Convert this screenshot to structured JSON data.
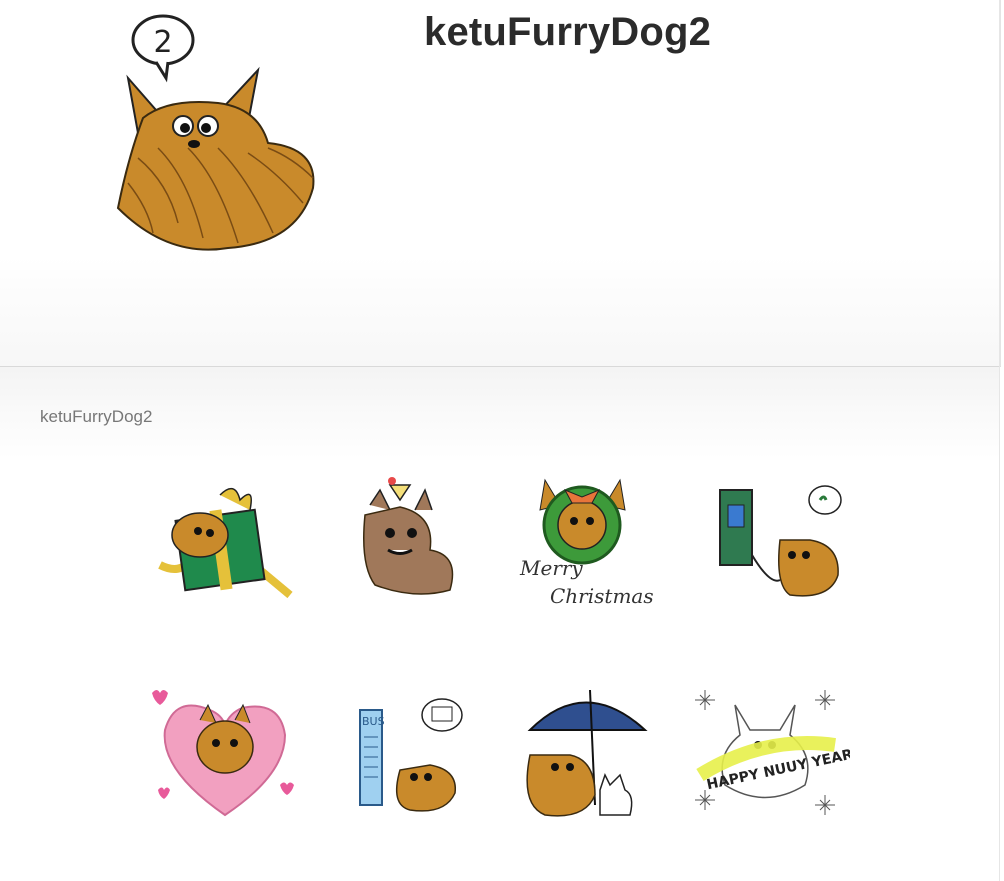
{
  "header": {
    "title": "ketuFurryDog2",
    "main_sticker_icon": "furry-dog-speech-bubble-2",
    "main_sticker_bubble_text": "2"
  },
  "pack": {
    "label": "ketuFurryDog2"
  },
  "stickers": [
    {
      "name": "dog-in-gift-box",
      "icon": "gift-box-dog"
    },
    {
      "name": "dog-with-cocktail-hat",
      "icon": "cocktail-dog"
    },
    {
      "name": "dog-christmas-wreath",
      "icon": "wreath-dog",
      "text": "Merry Christmas"
    },
    {
      "name": "dog-phone-booth",
      "icon": "phone-dog"
    },
    {
      "name": "dog-pink-heart",
      "icon": "heart-dog"
    },
    {
      "name": "dog-bus-stop",
      "icon": "bus-dog",
      "text": "BUS"
    },
    {
      "name": "dog-under-umbrella",
      "icon": "umbrella-dog"
    },
    {
      "name": "dog-happy-new-year",
      "icon": "new-year-dog",
      "text": "HAPPY NUUY YEAR"
    }
  ],
  "colors": {
    "fur": "#c98a2b",
    "fur_dark": "#8a5a1c",
    "brown_fur": "#a0785a",
    "gift_green": "#1f8a4c",
    "ribbon_yellow": "#e5c13a",
    "wreath_green": "#3d9a3a",
    "heart_pink": "#f2a0c0",
    "bus_blue": "#9fd0f0",
    "umbrella_blue": "#2f4f8f",
    "newyear_yellow": "#e7f04a"
  }
}
